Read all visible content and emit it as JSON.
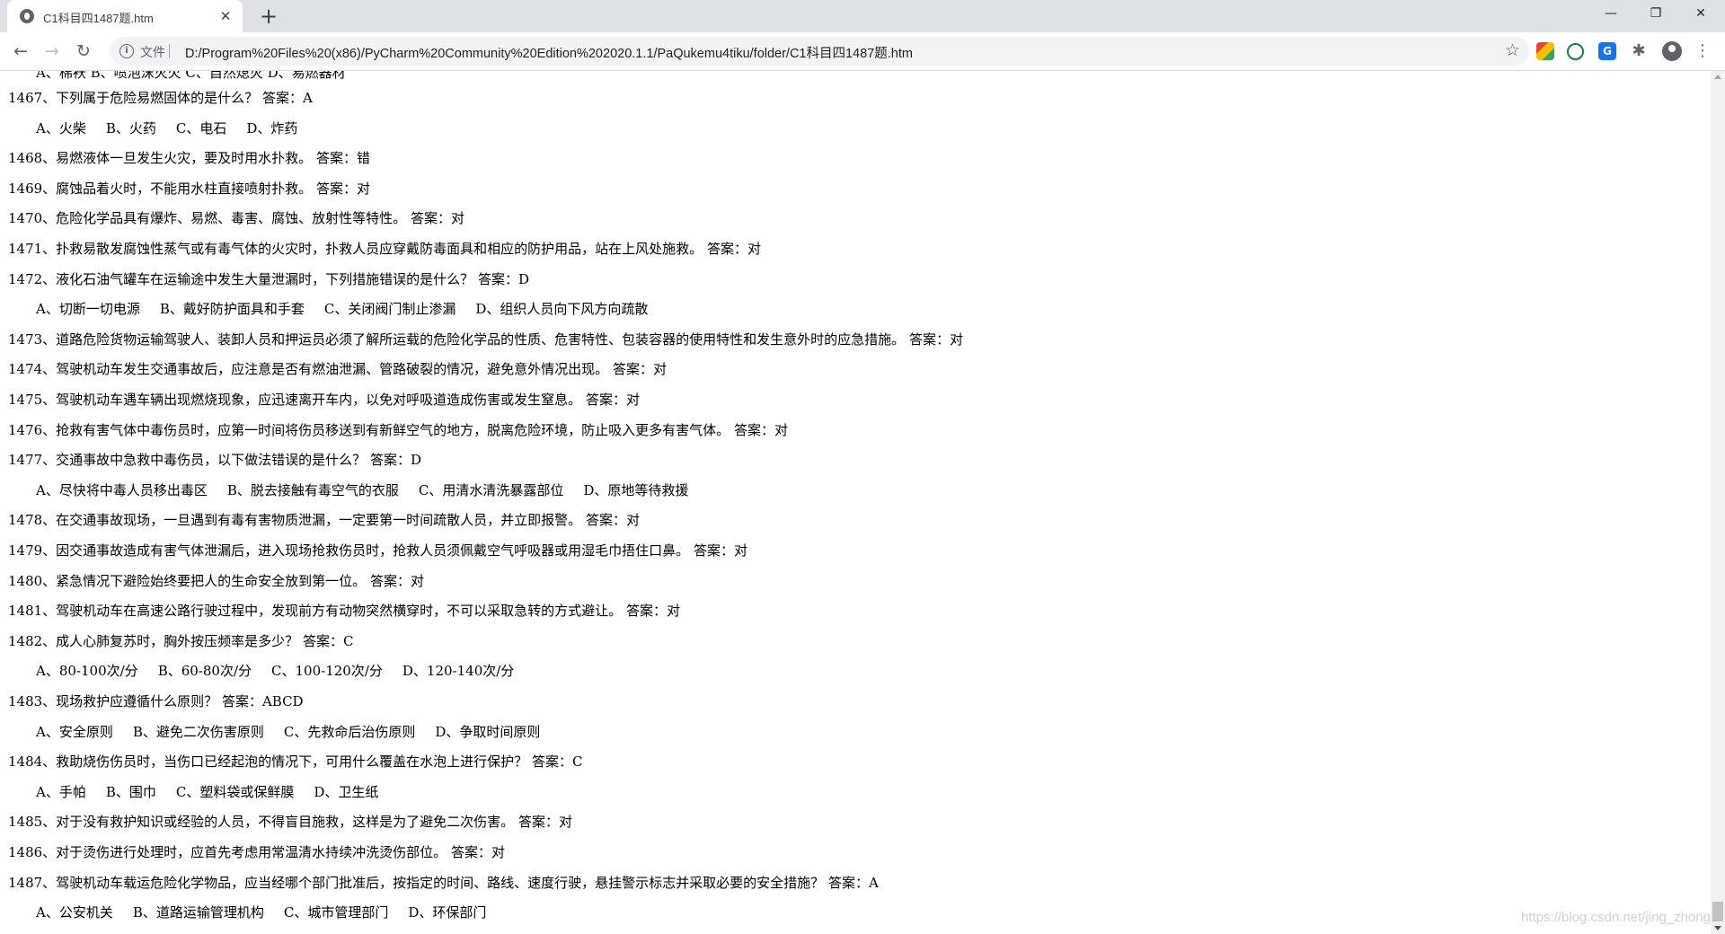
{
  "tab": {
    "title": "C1科目四1487题.htm",
    "close": "✕"
  },
  "newtab": "+",
  "window": {
    "minimize": "—",
    "maximize": "❐",
    "close": "✕"
  },
  "toolbar": {
    "back": "←",
    "forward": "→",
    "reload": "↻",
    "scheme": "文件",
    "url": "D:/Program%20Files%20(x86)/PyCharm%20Community%20Edition%202020.1.1/PaQukemu4tiku/folder/C1科目四1487题.htm",
    "bookmark": "☆",
    "translate": "G",
    "extensions": "✱",
    "menu": "⋮"
  },
  "cut_line": "A、棉袄  B、喷泡沫灭火  C、自然熄灭  D、易燃器材",
  "questions": [
    {
      "text": "1467、下列属于危险易燃固体的是什么？ 答案：A",
      "options": [
        "A、火柴",
        "B、火药",
        "C、电石",
        "D、炸药"
      ]
    },
    {
      "text": "1468、易燃液体一旦发生火灾，要及时用水扑救。 答案：错"
    },
    {
      "text": "1469、腐蚀品着火时，不能用水柱直接喷射扑救。 答案：对"
    },
    {
      "text": "1470、危险化学品具有爆炸、易燃、毒害、腐蚀、放射性等特性。 答案：对"
    },
    {
      "text": "1471、扑救易散发腐蚀性蒸气或有毒气体的火灾时，扑救人员应穿戴防毒面具和相应的防护用品，站在上风处施救。 答案：对"
    },
    {
      "text": "1472、液化石油气罐车在运输途中发生大量泄漏时，下列措施错误的是什么？ 答案：D",
      "options": [
        "A、切断一切电源",
        "B、戴好防护面具和手套",
        "C、关闭阀门制止渗漏",
        "D、组织人员向下风方向疏散"
      ]
    },
    {
      "text": "1473、道路危险货物运输驾驶人、装卸人员和押运员必须了解所运载的危险化学品的性质、危害特性、包装容器的使用特性和发生意外时的应急措施。 答案：对"
    },
    {
      "text": "1474、驾驶机动车发生交通事故后，应注意是否有燃油泄漏、管路破裂的情况，避免意外情况出现。 答案：对"
    },
    {
      "text": "1475、驾驶机动车遇车辆出现燃烧现象，应迅速离开车内，以免对呼吸道造成伤害或发生窒息。 答案：对"
    },
    {
      "text": "1476、抢救有害气体中毒伤员时，应第一时间将伤员移送到有新鲜空气的地方，脱离危险环境，防止吸入更多有害气体。 答案：对"
    },
    {
      "text": "1477、交通事故中急救中毒伤员，以下做法错误的是什么？ 答案：D",
      "options": [
        "A、尽快将中毒人员移出毒区",
        "B、脱去接触有毒空气的衣服",
        "C、用清水清洗暴露部位",
        "D、原地等待救援"
      ]
    },
    {
      "text": "1478、在交通事故现场，一旦遇到有毒有害物质泄漏，一定要第一时间疏散人员，并立即报警。 答案：对"
    },
    {
      "text": "1479、因交通事故造成有害气体泄漏后，进入现场抢救伤员时，抢救人员须佩戴空气呼吸器或用湿毛巾捂住口鼻。 答案：对"
    },
    {
      "text": "1480、紧急情况下避险始终要把人的生命安全放到第一位。 答案：对"
    },
    {
      "text": "1481、驾驶机动车在高速公路行驶过程中，发现前方有动物突然横穿时，不可以采取急转的方式避让。 答案：对"
    },
    {
      "text": "1482、成人心肺复苏时，胸外按压频率是多少？ 答案：C",
      "options": [
        "A、80-100次/分",
        "B、60-80次/分",
        "C、100-120次/分",
        "D、120-140次/分"
      ]
    },
    {
      "text": "1483、现场救护应遵循什么原则？ 答案：ABCD",
      "options": [
        "A、安全原则",
        "B、避免二次伤害原则",
        "C、先救命后治伤原则",
        "D、争取时间原则"
      ]
    },
    {
      "text": "1484、救助烧伤伤员时，当伤口已经起泡的情况下，可用什么覆盖在水泡上进行保护？ 答案：C",
      "options": [
        "A、手帕",
        "B、围巾",
        "C、塑料袋或保鲜膜",
        "D、卫生纸"
      ]
    },
    {
      "text": "1485、对于没有救护知识或经验的人员，不得盲目施救，这样是为了避免二次伤害。 答案：对"
    },
    {
      "text": "1486、对于烫伤进行处理时，应首先考虑用常温清水持续冲洗烫伤部位。 答案：对"
    },
    {
      "text": "1487、驾驶机动车载运危险化学物品，应当经哪个部门批准后，按指定的时间、路线、速度行驶，悬挂警示标志并采取必要的安全措施？ 答案：A",
      "options": [
        "A、公安机关",
        "B、道路运输管理机构",
        "C、城市管理部门",
        "D、环保部门"
      ]
    }
  ],
  "watermark": "https://blog.csdn.net/jing_zhong"
}
